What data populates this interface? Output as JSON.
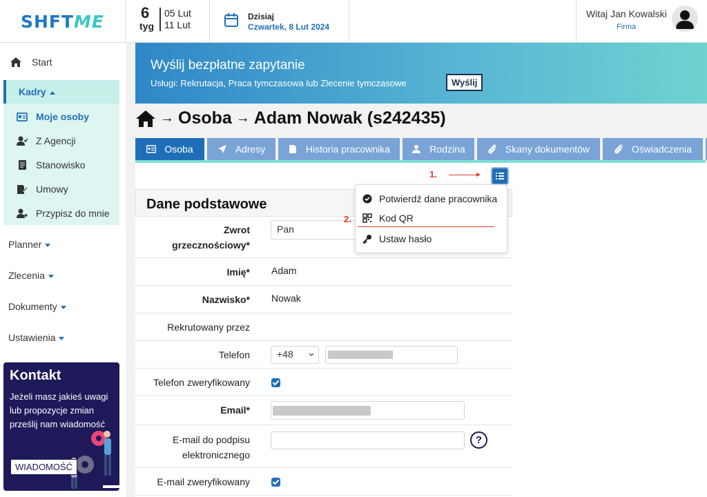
{
  "header": {
    "logo": {
      "shft": "SHFT",
      "me": "ME"
    },
    "week": {
      "number": "6",
      "label": "tyg",
      "from": "05 Lut",
      "to": "11 Lut"
    },
    "today": {
      "label": "Dzisiaj",
      "date": "Czwartek, 8 Lut 2024"
    },
    "user": {
      "greeting": "Witaj Jan Kowalski",
      "company": "Firma"
    }
  },
  "sidebar": {
    "start": "Start",
    "kadry": "Kadry",
    "kadry_items": [
      {
        "label": "Moje osoby",
        "icon": "id-card-icon",
        "active": true
      },
      {
        "label": "Z Agencji",
        "icon": "user-check-icon"
      },
      {
        "label": "Stanowisko",
        "icon": "document-icon"
      },
      {
        "label": "Umowy",
        "icon": "contract-edit-icon"
      },
      {
        "label": "Przypisz do mnie",
        "icon": "user-assign-icon"
      }
    ],
    "menus": [
      "Planner",
      "Zlecenia",
      "Dokumenty",
      "Ustawienia"
    ],
    "contact": {
      "title": "Kontakt",
      "text": "Jeżeli masz jakieś uwagi lub propozycje zmian prześlij nam wiadomość",
      "button": "WIADOMOŚĆ"
    }
  },
  "banner": {
    "title": "Wyślij bezpłatne zapytanie",
    "subtitle": "Usługi: Rekrutacja, Praca tymczasowa lub Zlecenie tymczasowe",
    "button": "Wyślij"
  },
  "breadcrumb": {
    "section": "Osoba",
    "person": "Adam Nowak (s242435)"
  },
  "tabs": [
    "Osoba",
    "Adresy",
    "Historia pracownika",
    "Rodzina",
    "Skany dokumentów",
    "Oświadczenia"
  ],
  "annotations": {
    "one": "1.",
    "two": "2."
  },
  "dropdown": [
    "Potwierdź dane pracownika",
    "Kod QR",
    "Ustaw hasło"
  ],
  "section": {
    "title": "Dane podstawowe"
  },
  "form": {
    "salutation_label_1": "Zwrot",
    "salutation_label_2": "grzecznościowy*",
    "salutation_value": "Pan",
    "first_name_label": "Imię*",
    "first_name_value": "Adam",
    "last_name_label": "Nazwisko*",
    "last_name_value": "Nowak",
    "recruited_by_label": "Rekrutowany przez",
    "phone_label": "Telefon",
    "phone_prefix": "+48",
    "phone_verified_label": "Telefon zweryfikowany",
    "email_label": "Email*",
    "esign_email_label_1": "E-mail do podpisu",
    "esign_email_label_2": "elektronicznego",
    "email_verified_label": "E-mail zweryfikowany",
    "help_symbol": "?"
  },
  "colors": {
    "primary": "#1f6fb8",
    "tab_inactive": "#7aa3d6",
    "annotation": "#e33b2e",
    "kadry_bg": "#ddf6f1",
    "contact_bg": "#1e1a5a"
  }
}
